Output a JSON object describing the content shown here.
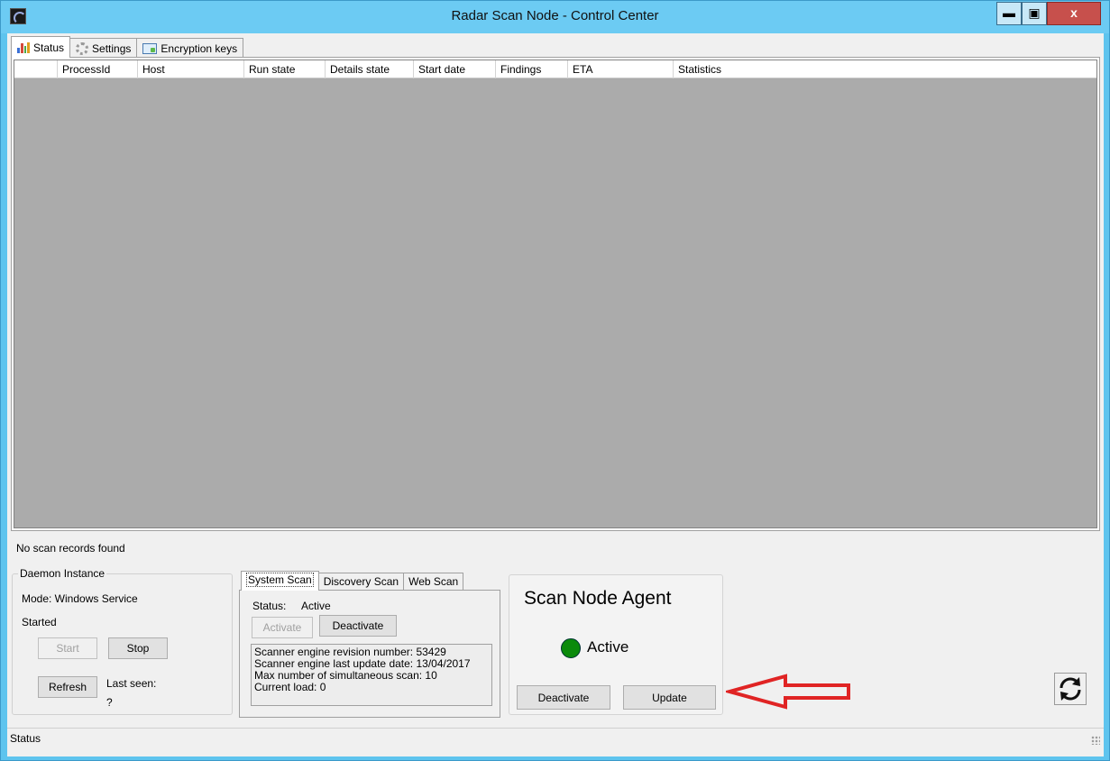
{
  "window": {
    "title": "Radar Scan Node - Control Center",
    "close_glyph": "x",
    "min_glyph": "▬",
    "max_glyph": "▣"
  },
  "tabs": [
    {
      "label": "Status",
      "icon": "bar-chart-icon"
    },
    {
      "label": "Settings",
      "icon": "gear-icon"
    },
    {
      "label": "Encryption keys",
      "icon": "key-folder-icon"
    }
  ],
  "grid": {
    "columns": [
      "",
      "ProcessId",
      "Host",
      "Run state",
      "Details state",
      "Start date",
      "Findings",
      "ETA",
      "Statistics"
    ]
  },
  "status_message": "No scan records found",
  "daemon": {
    "legend": "Daemon Instance",
    "mode": "Mode: Windows Service",
    "state": "Started",
    "start_label": "Start",
    "stop_label": "Stop",
    "refresh_label": "Refresh",
    "last_seen_label": "Last seen:",
    "last_seen_value": "?"
  },
  "scan_tabs": [
    {
      "label": "System Scan"
    },
    {
      "label": "Discovery Scan"
    },
    {
      "label": "Web Scan"
    }
  ],
  "system_scan": {
    "status_label": "Status:",
    "status_value": "Active",
    "activate_label": "Activate",
    "deactivate_label": "Deactivate",
    "info": [
      "Scanner engine revision number: 53429",
      "Scanner engine last update date: 13/04/2017",
      "Max number of simultaneous scan: 10",
      "Current load: 0"
    ]
  },
  "agent": {
    "title": "Scan Node Agent",
    "status": "Active",
    "status_color": "#0b8a0b",
    "deactivate_label": "Deactivate",
    "update_label": "Update"
  },
  "annotation": {
    "arrow_color": "#e02424"
  },
  "statusbar": {
    "text": "Status"
  }
}
